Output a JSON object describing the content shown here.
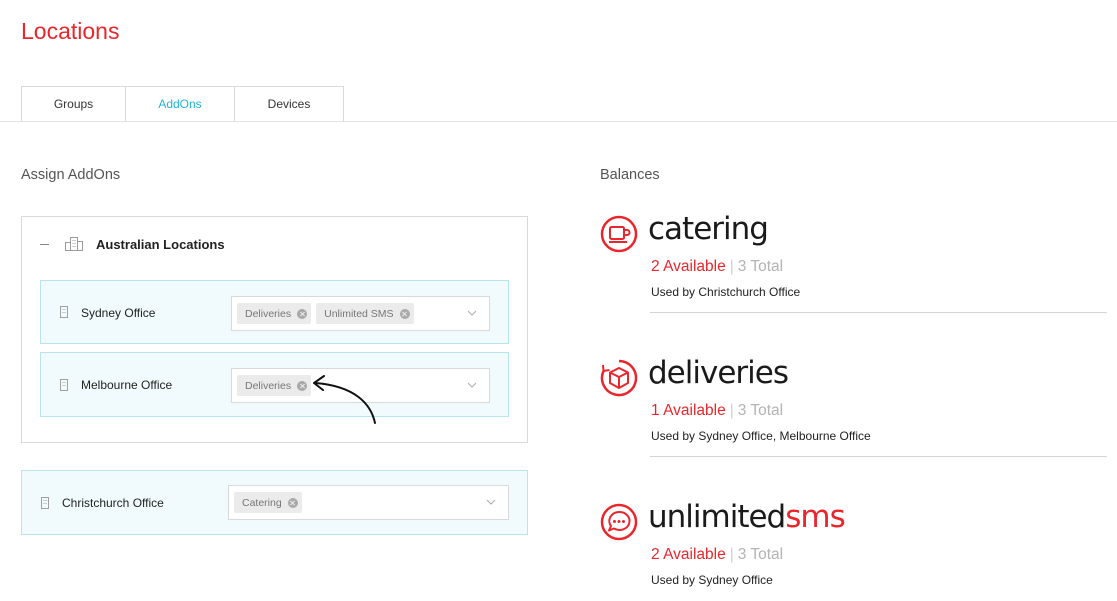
{
  "page": {
    "title": "Locations"
  },
  "tabs": [
    {
      "label": "Groups",
      "active": false
    },
    {
      "label": "AddOns",
      "active": true
    },
    {
      "label": "Devices",
      "active": false
    }
  ],
  "assign": {
    "title": "Assign AddOns",
    "group": {
      "name": "Australian Locations",
      "locations": [
        {
          "name": "Sydney Office",
          "addons": [
            "Deliveries",
            "Unlimited SMS"
          ]
        },
        {
          "name": "Melbourne Office",
          "addons": [
            "Deliveries"
          ]
        }
      ]
    },
    "standalone": [
      {
        "name": "Christchurch Office",
        "addons": [
          "Catering"
        ]
      }
    ]
  },
  "balances": {
    "title": "Balances",
    "items": [
      {
        "logo": "catering",
        "logo_accent": "",
        "icon": "cup-icon",
        "available": "2 Available",
        "separator": "|",
        "total": "3 Total",
        "used_by": "Used by Christchurch Office"
      },
      {
        "logo": "deliveries",
        "logo_accent": "",
        "icon": "box-icon",
        "available": "1 Available",
        "separator": "|",
        "total": "3 Total",
        "used_by": "Used by Sydney Office, Melbourne Office"
      },
      {
        "logo": "unlimited",
        "logo_accent": "sms",
        "icon": "chat-icon",
        "available": "2 Available",
        "separator": "|",
        "total": "3 Total",
        "used_by": "Used by Sydney Office"
      }
    ]
  },
  "colors": {
    "brand_red": "#e8262c",
    "accent_cyan": "#22b3d6",
    "row_bg": "#f1fbfd",
    "row_border": "#b9e4ef"
  }
}
